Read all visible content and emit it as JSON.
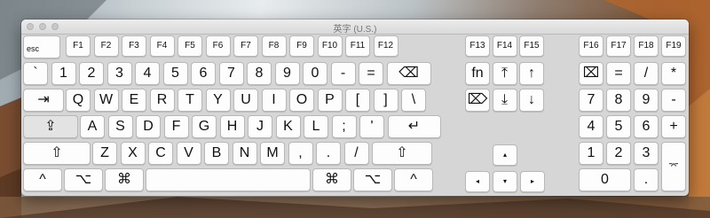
{
  "window": {
    "title": "英字 (U.S.)"
  },
  "function_row": {
    "esc": "esc",
    "left": [
      "F1",
      "F2",
      "F3",
      "F4",
      "F5",
      "F6",
      "F7",
      "F8",
      "F9",
      "F10",
      "F11",
      "F12"
    ],
    "middle": [
      "F13",
      "F14",
      "F15"
    ],
    "right": [
      "F16",
      "F17",
      "F18",
      "F19"
    ]
  },
  "main": {
    "number_row": [
      "`",
      "1",
      "2",
      "3",
      "4",
      "5",
      "6",
      "7",
      "8",
      "9",
      "0",
      "-",
      "=",
      "⌫"
    ],
    "qwerty_row": [
      "⇥",
      "Q",
      "W",
      "E",
      "R",
      "T",
      "Y",
      "U",
      "I",
      "O",
      "P",
      "[",
      "]",
      "\\"
    ],
    "home_row": [
      "⇪",
      "A",
      "S",
      "D",
      "F",
      "G",
      "H",
      "J",
      "K",
      "L",
      ";",
      "'",
      "↵"
    ],
    "shift_row": [
      "⇧",
      "Z",
      "X",
      "C",
      "V",
      "B",
      "N",
      "M",
      ",",
      ".",
      "/",
      "⇧"
    ],
    "bottom_row": [
      "^",
      "⌥",
      "⌘",
      "",
      "⌘",
      "⌥",
      "^"
    ]
  },
  "nav": {
    "row1": [
      "fn",
      "⤒",
      "↑"
    ],
    "row2": [
      "⌦",
      "⤓",
      "↓"
    ],
    "arrows": {
      "up": "▴",
      "left": "◂",
      "down": "▾",
      "right": "▸"
    }
  },
  "numpad": {
    "row1": [
      "⌧",
      "=",
      "/",
      "*"
    ],
    "row2": [
      "7",
      "8",
      "9",
      "-"
    ],
    "row3": [
      "4",
      "5",
      "6",
      "+"
    ],
    "row4": [
      "1",
      "2",
      "3"
    ],
    "row5": [
      "0",
      "."
    ],
    "enter": "⌤"
  }
}
